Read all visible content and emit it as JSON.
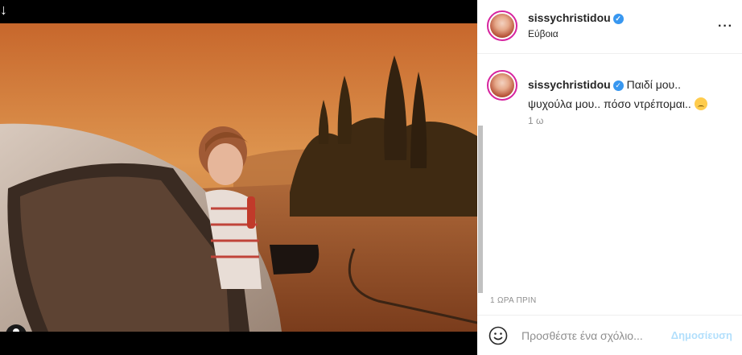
{
  "post": {
    "username": "sissychristidou",
    "location": "Εύβοια",
    "caption_line1": "Παιδί μου..",
    "caption_line2": "ψυχούλα μου.. πόσο ντρέπομαι..",
    "caption_time": "1 ω",
    "time_ago": "1 ΩΡΑ ΠΡΙΝ"
  },
  "comment": {
    "placeholder": "Προσθέστε ένα σχόλιο...",
    "post_label": "Δημοσίευση"
  },
  "icons": {
    "download": "download-arrow-icon",
    "more": "more-options-icon",
    "verified": "verified-badge-icon",
    "emoji": "emoji-icon",
    "user_tag": "user-tag-icon"
  },
  "colors": {
    "verified": "#3897f0",
    "post_button": "#b2dffc",
    "avatar_ring": "#d6249f"
  }
}
